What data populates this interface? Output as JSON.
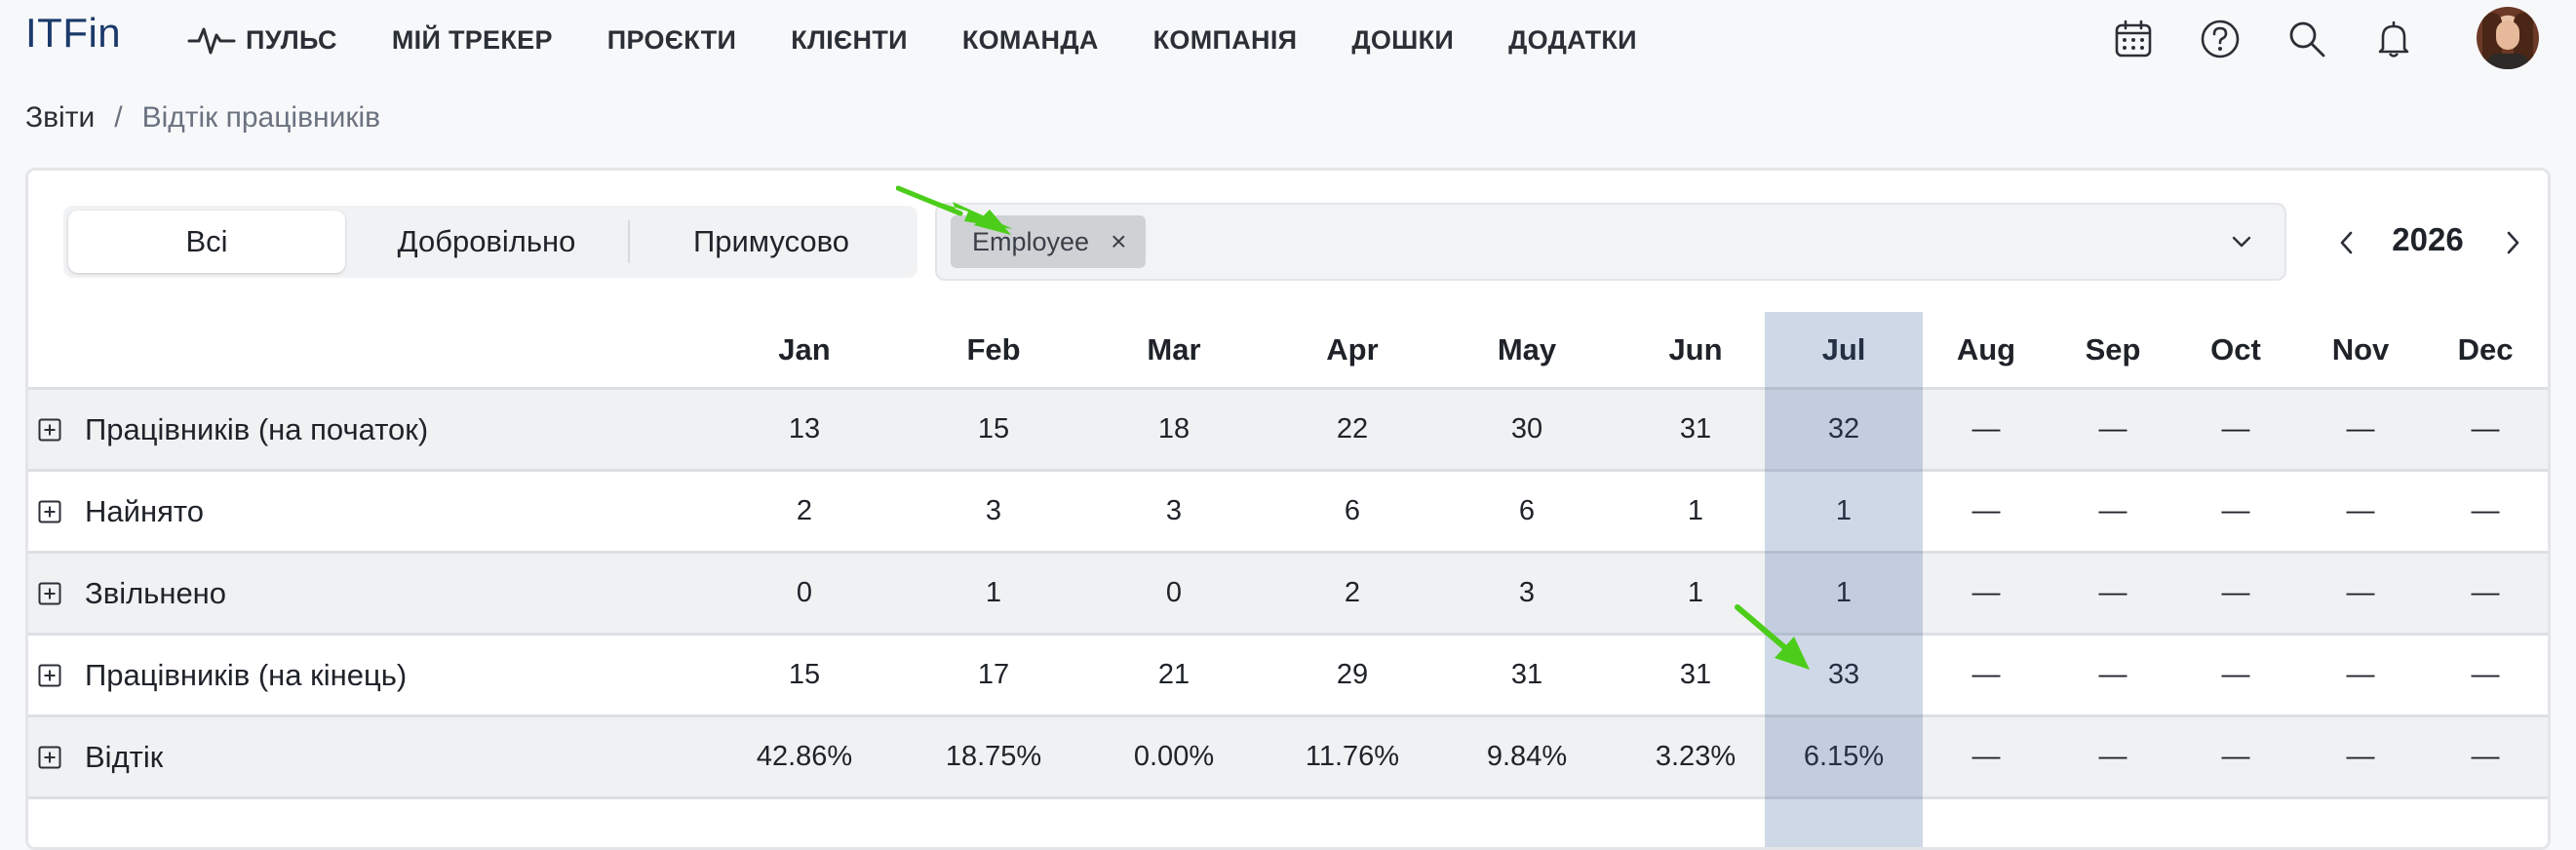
{
  "app": {
    "logo": "ITFin"
  },
  "nav": {
    "items": [
      {
        "label": "ПУЛЬС",
        "icon": "pulse-icon"
      },
      {
        "label": "МІЙ ТРЕКЕР"
      },
      {
        "label": "ПРОЄКТИ"
      },
      {
        "label": "КЛІЄНТИ"
      },
      {
        "label": "КОМАНДА"
      },
      {
        "label": "КОМПАНІЯ"
      },
      {
        "label": "ДОШКИ"
      },
      {
        "label": "ДОДАТКИ"
      }
    ],
    "icons": [
      "calendar-icon",
      "help-icon",
      "search-icon",
      "bell-icon"
    ]
  },
  "breadcrumb": {
    "root": "Звіти",
    "separator": "/",
    "current": "Відтік працівників"
  },
  "filters": {
    "segments": [
      "Всі",
      "Добровільно",
      "Примусово"
    ],
    "active_segment": "Всі",
    "selected_chip": "Employee",
    "chip_remove": "×"
  },
  "year": {
    "value": "2026"
  },
  "table": {
    "months": [
      "Jan",
      "Feb",
      "Mar",
      "Apr",
      "May",
      "Jun",
      "Jul",
      "Aug",
      "Sep",
      "Oct",
      "Nov",
      "Dec"
    ],
    "highlighted_month": "Jul",
    "rows": [
      {
        "label": "Працівників (на початок)",
        "values": [
          "13",
          "15",
          "18",
          "22",
          "30",
          "31",
          "32",
          "—",
          "—",
          "—",
          "—",
          "—"
        ]
      },
      {
        "label": "Найнято",
        "values": [
          "2",
          "3",
          "3",
          "6",
          "6",
          "1",
          "1",
          "—",
          "—",
          "—",
          "—",
          "—"
        ]
      },
      {
        "label": "Звільнено",
        "values": [
          "0",
          "1",
          "0",
          "2",
          "3",
          "1",
          "1",
          "—",
          "—",
          "—",
          "—",
          "—"
        ]
      },
      {
        "label": "Працівників (на кінець)",
        "values": [
          "15",
          "17",
          "21",
          "29",
          "31",
          "31",
          "33",
          "—",
          "—",
          "—",
          "—",
          "—"
        ]
      },
      {
        "label": "Відтік",
        "values": [
          "42.86%",
          "18.75%",
          "0.00%",
          "11.76%",
          "9.84%",
          "3.23%",
          "6.15%",
          "—",
          "—",
          "—",
          "—",
          "—"
        ]
      }
    ]
  },
  "colors": {
    "accent": "#1b3a6b",
    "highlight": "#c7d0de",
    "annotation_arrow": "#4ccd1a"
  }
}
